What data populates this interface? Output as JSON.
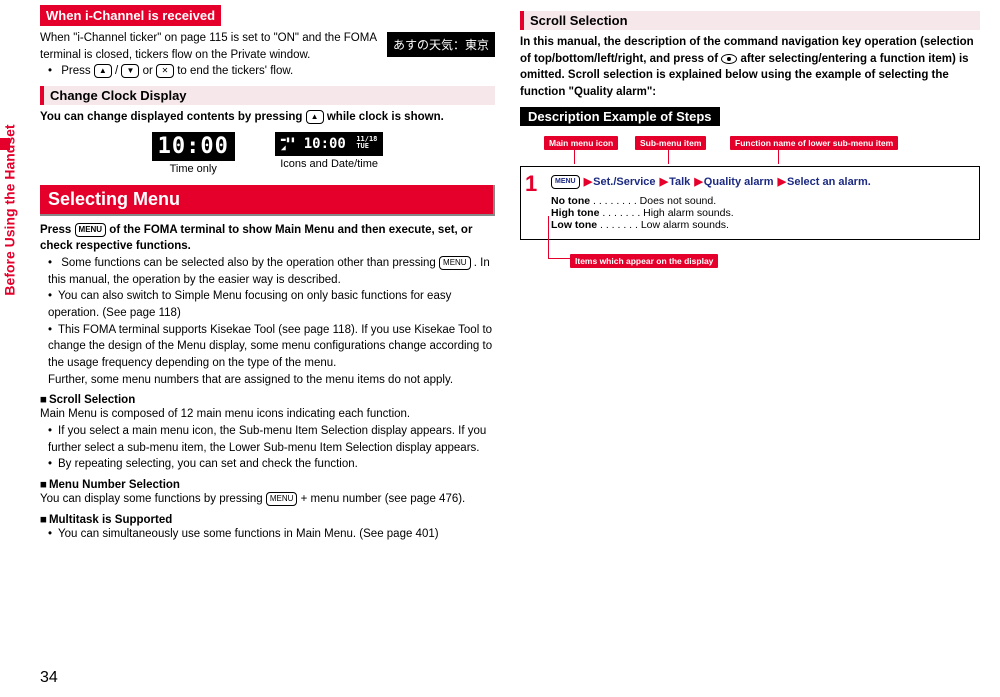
{
  "side_label": "Before Using the Handset",
  "page_number": "34",
  "col1": {
    "when_header": "When i-Channel is received",
    "when_p1": "When \"i-Channel ticker\" on page 115 is set to \"ON\" and the FOMA terminal is closed, tickers flow on the Private window.",
    "when_b1": "Press ",
    "when_b2": "/",
    "when_b3": " or ",
    "when_b4": " to end the tickers' flow.",
    "ticker_text": "あすの天気：東京",
    "change_header": "Change Clock Display",
    "change_p1a": "You can change displayed contents by pressing ",
    "change_p1b": " while clock is shown.",
    "clock1_value": "10:00",
    "clock1_label": "Time only",
    "clock2_value": "10:00",
    "clock2_date1": "11/18",
    "clock2_date2": "TUE",
    "clock2_label": "Icons and Date/time",
    "selecting_header": "Selecting Menu",
    "sel_p1a": "Press ",
    "sel_p1b": " of the FOMA terminal to show Main Menu and then execute, set, or check respective functions.",
    "sel_li1a": "Some functions can be selected also by the operation other than pressing ",
    "sel_li1b": ". In this manual, the operation by the easier way is described.",
    "sel_li2": "You can also switch to Simple Menu focusing on only basic functions for easy operation. (See page 118)",
    "sel_li3": "This FOMA terminal supports Kisekae Tool (see page 118). If you use Kisekae Tool to change the design of the Menu display, some menu configurations change according to the usage frequency depending on the type of the menu.\nFurther, some menu numbers that are assigned to the menu items do not apply.",
    "sub_scroll": "Scroll Selection",
    "sub_scroll_p": "Main Menu is composed of 12 main menu icons indicating each function.",
    "sub_scroll_li1": "If you select a main menu icon, the Sub-menu Item Selection display appears. If you further select a sub-menu item, the Lower Sub-menu Item Selection display appears.",
    "sub_scroll_li2": "By repeating selecting, you can set and check the function.",
    "sub_menu_num": "Menu Number Selection",
    "sub_menu_num_p_a": "You can display some functions by pressing ",
    "sub_menu_num_p_b": " + menu number (see page 476).",
    "sub_multi": "Multitask is Supported",
    "sub_multi_li": "You can simultaneously use some functions in Main Menu. (See page 401)"
  },
  "col2": {
    "scroll_header": "Scroll Selection",
    "scroll_p1a": "In this manual, the description of the command navigation key operation (selection of top/bottom/left/right, and press of ",
    "scroll_p1b": " after selecting/entering a function item) is omitted. Scroll selection is explained below using the example of selecting the function \"Quality alarm\":",
    "desc_header": "Description Example of Steps",
    "callout1": "Main menu icon",
    "callout2": "Sub-menu item",
    "callout3": "Function name of lower sub-menu item",
    "step_num": "1",
    "step_menu": "MENU",
    "step_path1": "Set./Service",
    "step_path2": "Talk",
    "step_path3": "Quality alarm",
    "step_path4": "Select an alarm.",
    "opt1a": "No tone",
    "opt1b": " . . . . . . . . Does not sound.",
    "opt2a": "High tone",
    "opt2b": " . . . . . . . High alarm sounds.",
    "opt3a": "Low tone",
    "opt3b": " . . . . . . . Low alarm sounds.",
    "callout_bottom": "Items which appear on the display"
  },
  "keys": {
    "up": "▲",
    "down": "▼",
    "cancel": "✕",
    "menu": "MENU"
  }
}
